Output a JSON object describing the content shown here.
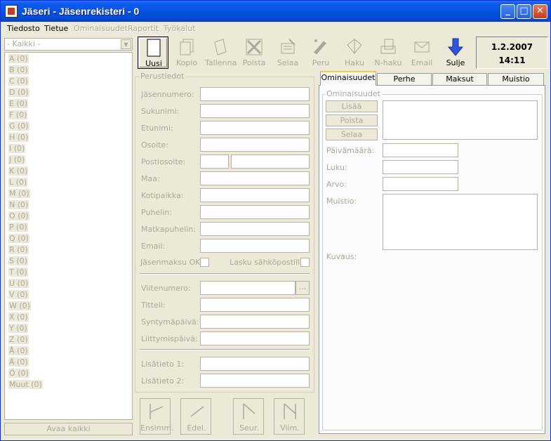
{
  "window": {
    "title": "Jäseri - Jäsenrekisteri - 0"
  },
  "menu": {
    "tiedosto": "Tiedosto",
    "tietue": "Tietue",
    "ominaisuudet": "Ominaisuudet",
    "raportit": "Raportit",
    "tyokalut": "Työkalut"
  },
  "filter": {
    "selected": "- Kaikki -"
  },
  "letters": [
    {
      "letter": "A",
      "count": "(0)"
    },
    {
      "letter": "B",
      "count": "(0)"
    },
    {
      "letter": "C",
      "count": "(0)"
    },
    {
      "letter": "D",
      "count": "(0)"
    },
    {
      "letter": "E",
      "count": "(0)"
    },
    {
      "letter": "F",
      "count": "(0)"
    },
    {
      "letter": "G",
      "count": "(0)"
    },
    {
      "letter": "H",
      "count": "(0)"
    },
    {
      "letter": "I",
      "count": "(0)"
    },
    {
      "letter": "J",
      "count": "(0)"
    },
    {
      "letter": "K",
      "count": "(0)"
    },
    {
      "letter": "L",
      "count": "(0)"
    },
    {
      "letter": "M",
      "count": "(0)"
    },
    {
      "letter": "N",
      "count": "(0)"
    },
    {
      "letter": "O",
      "count": "(0)"
    },
    {
      "letter": "P",
      "count": "(0)"
    },
    {
      "letter": "Q",
      "count": "(0)"
    },
    {
      "letter": "R",
      "count": "(0)"
    },
    {
      "letter": "S",
      "count": "(0)"
    },
    {
      "letter": "T",
      "count": "(0)"
    },
    {
      "letter": "U",
      "count": "(0)"
    },
    {
      "letter": "V",
      "count": "(0)"
    },
    {
      "letter": "W",
      "count": "(0)"
    },
    {
      "letter": "X",
      "count": "(0)"
    },
    {
      "letter": "Y",
      "count": "(0)"
    },
    {
      "letter": "Z",
      "count": "(0)"
    },
    {
      "letter": "Å",
      "count": "(0)"
    },
    {
      "letter": "Ä",
      "count": "(0)"
    },
    {
      "letter": "Ö",
      "count": "(0)"
    },
    {
      "letter": "Muut",
      "count": "(0)"
    }
  ],
  "open_all": "Avaa kaikki",
  "toolbar": {
    "uusi": "Uusi",
    "kopio": "Kopio",
    "tallenna": "Tallenna",
    "poista": "Poista",
    "selaa": "Selaa",
    "peru": "Peru",
    "haku": "Haku",
    "nhaku": "N-haku",
    "email": "Email",
    "sulje": "Sulje"
  },
  "datetime": {
    "date": "1.2.2007",
    "time": "14:11"
  },
  "basic": {
    "title": "Perustiedot",
    "jasennumero": "Jäsennumero:",
    "sukunimi": "Sukunimi:",
    "etunimi": "Etunimi:",
    "osoite": "Osoite:",
    "postiosoite": "Postiosoite:",
    "maa": "Maa:",
    "kotipaikka": "Kotipaikka:",
    "puhelin": "Puhelin:",
    "matkapuhelin": "Matkapuhelin:",
    "email": "Email:",
    "jasenmaksu": "Jäsenmaksu OK:",
    "lasku": "Lasku sähköpostilla:",
    "viitenumero": "Viitenumero:",
    "viite_button": "...",
    "titteli": "Titteli:",
    "syntymapaiva": "Syntymäpäivä:",
    "liittymispaiva": "Liittymispäivä:",
    "lisatieto1": "Lisätieto 1:",
    "lisatieto2": "Lisätieto 2:"
  },
  "nav": {
    "first": "Ensimm.",
    "prev": "Edel.",
    "next": "Seur.",
    "last": "Viim."
  },
  "tabs": {
    "ominaisuudet": "Ominaisuudet",
    "perhe": "Perhe",
    "maksut": "Maksut",
    "muistio": "Muistio"
  },
  "props": {
    "title": "Ominaisuudet",
    "lisaa": "Lisää",
    "poista": "Poista",
    "selaa": "Selaa",
    "paivamaara": "Päivämäärä:",
    "luku": "Luku:",
    "arvo": "Arvo:",
    "muistio": "Muistio:",
    "kuvaus": "Kuvaus:"
  }
}
